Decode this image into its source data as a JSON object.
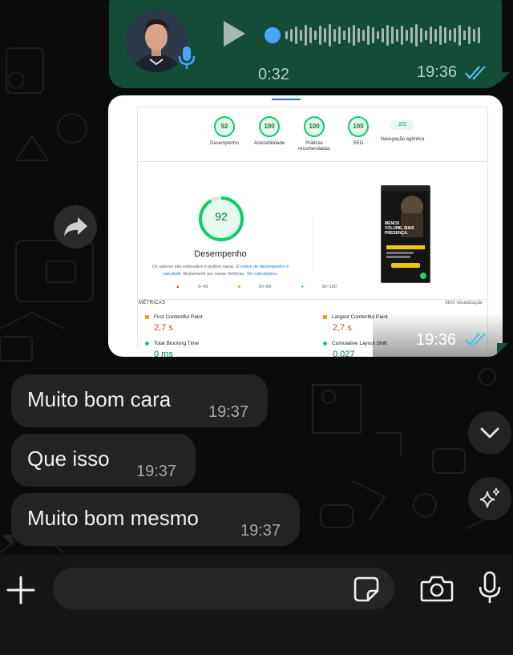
{
  "voice_message": {
    "duration": "0:32",
    "time": "19:36",
    "status": "read",
    "icons": [
      "play-icon",
      "microphone-badge-icon",
      "double-check-icon"
    ]
  },
  "image_message": {
    "time": "19:36",
    "status": "read",
    "content": {
      "scores": [
        {
          "value": "92",
          "label": "Desempenho"
        },
        {
          "value": "100",
          "label": "Acessibilidade"
        },
        {
          "value": "100",
          "label": "Práticas recomendadas"
        },
        {
          "value": "100",
          "label": "SEO"
        },
        {
          "value": "2/2",
          "label": "Navegação agêntica"
        }
      ],
      "main_score": "92",
      "main_label": "Desempenho",
      "desc_part1": "Os valores são estimados e podem variar.",
      "desc_link1": "O índice de desempenho é calculado",
      "desc_part2": "diretamente por essas métricas.",
      "desc_link2": "Ver calculadora.",
      "legend": [
        "0–49",
        "50–89",
        "90–100"
      ],
      "metrics_header": "MÉTRICAS",
      "expand_view": "Abrir visualização",
      "metrics": [
        {
          "name": "First Contentful Paint",
          "value": "2,7 s"
        },
        {
          "name": "Largest Contentful Paint",
          "value": "2,7 s"
        },
        {
          "name": "Total Blocking Time",
          "value": "0 ms"
        },
        {
          "name": "Cumulative Layout Shift",
          "value": "0,027"
        }
      ],
      "preview_headline": "MENOS VOLUME. MAIS PRESENÇA."
    }
  },
  "messages": [
    {
      "text": "Muito bom cara",
      "time": "19:37"
    },
    {
      "text": "Que isso",
      "time": "19:37"
    },
    {
      "text": "Muito bom mesmo",
      "time": "19:37"
    }
  ],
  "composer": {
    "placeholder": ""
  },
  "colors": {
    "outgoing_bubble": "#134d37",
    "incoming_bubble": "#232323",
    "background": "#0b0b0b",
    "read_ticks": "#53bdeb",
    "play_progress": "#4aa3ff"
  }
}
